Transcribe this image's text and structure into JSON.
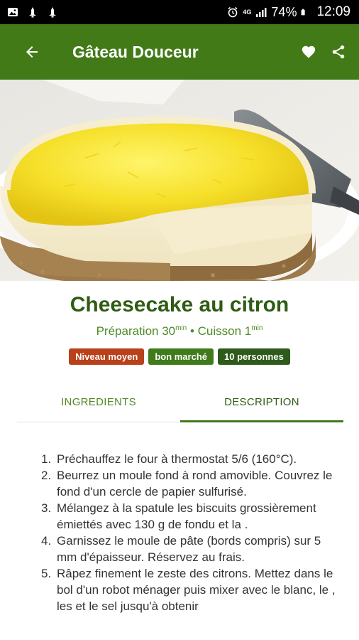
{
  "status_bar": {
    "left_icons": [
      "gallery-icon",
      "notification-icon",
      "notification-icon"
    ],
    "network": "4G",
    "battery": "74%",
    "time": "12:09"
  },
  "app_bar": {
    "title": "Gâteau Douceur",
    "icons": [
      "back-arrow-icon",
      "heart-icon",
      "share-icon"
    ]
  },
  "recipe": {
    "title": "Cheesecake au citron",
    "prep_label": "Préparation 30",
    "prep_unit": "min",
    "separator": " • ",
    "cook_label": "Cuisson 1",
    "cook_unit": "min",
    "badges": {
      "level": "Niveau moyen",
      "price": "bon marché",
      "persons": "10 personnes"
    }
  },
  "tabs": {
    "ingredients": "INGREDIENTS",
    "description": "DESCRIPTION",
    "active": "description"
  },
  "steps": [
    {
      "num": "1.",
      "text": "Préchauffez le four à thermostat 5/6 (160°C)."
    },
    {
      "num": "2.",
      "text": "Beurrez un moule fond à rond amovible. Couvrez le fond d'un cercle de papier sulfurisé."
    },
    {
      "num": "3.",
      "text": "Mélangez à la spatule les biscuits grossièrement émiettés avec 130 g de fondu et la ."
    },
    {
      "num": "4.",
      "text": "Garnissez le moule de pâte (bords compris) sur 5 mm d'épaisseur. Réservez au frais."
    },
    {
      "num": "5.",
      "text": "Râpez finement le zeste des citrons. Mettez dans le bol d'un robot ménager puis mixer avec le blanc, le , les et le sel jusqu'à obtenir"
    }
  ],
  "colors": {
    "app_bar": "#427a17",
    "title_green": "#2f5c14",
    "accent_green": "#4f8a25",
    "badge_level": "#b8401a",
    "badge_price": "#3f7a1b",
    "badge_persons": "#2e5a1b"
  }
}
